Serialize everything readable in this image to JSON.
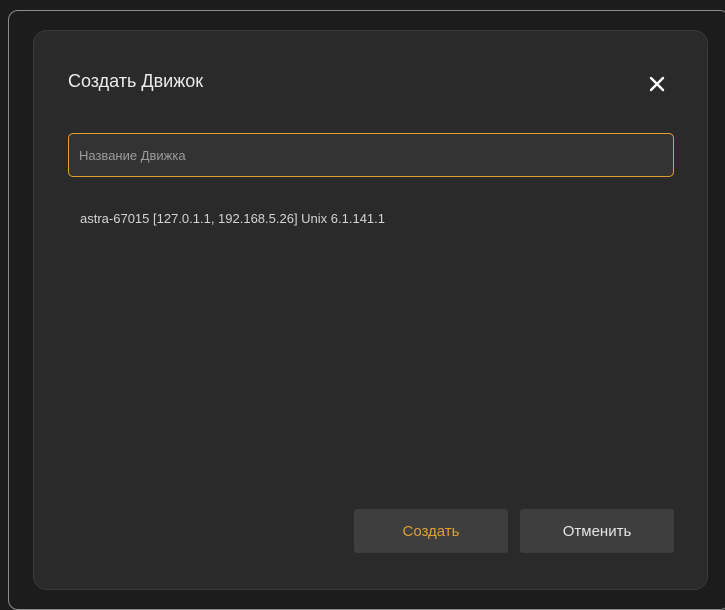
{
  "dialog": {
    "title": "Создать Движок",
    "close_icon": "close-icon",
    "name_input": {
      "placeholder": "Название Движка",
      "value": ""
    },
    "host_entry": "astra-67015 [127.0.1.1, 192.168.5.26] Unix 6.1.141.1",
    "buttons": {
      "create_label": "Создать",
      "cancel_label": "Отменить"
    }
  },
  "colors": {
    "accent": "#e0a02e",
    "dialog_bg": "#2a2a2a",
    "page_bg": "#1c1c1c",
    "button_bg": "#3e3e3e"
  }
}
